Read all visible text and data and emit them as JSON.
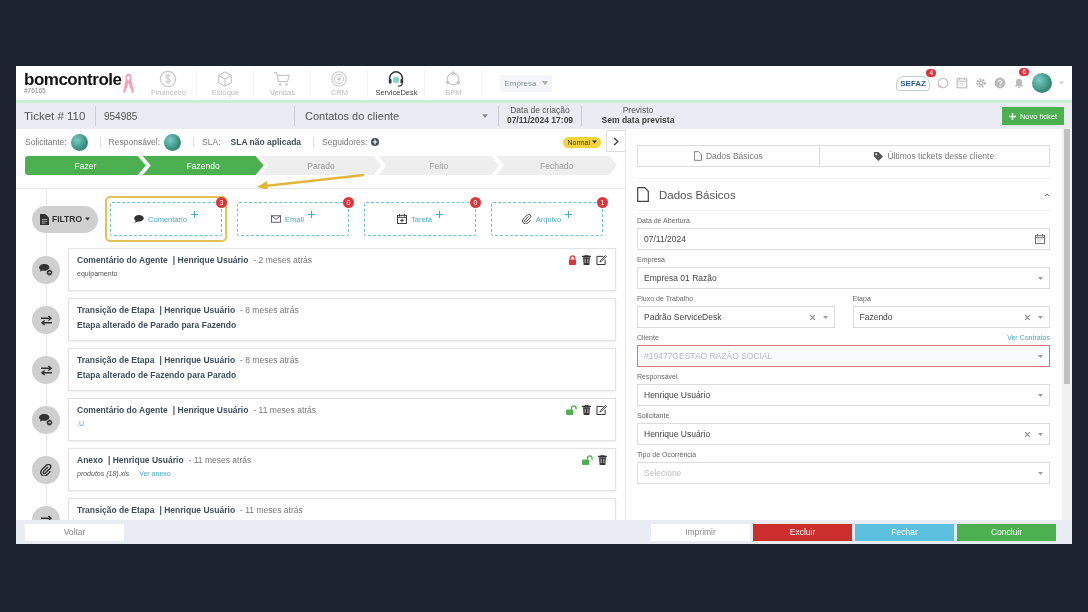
{
  "logo": {
    "text": "bomcontrole",
    "subtext": "#76165"
  },
  "modules": [
    {
      "label": "Financeiro",
      "selected": false
    },
    {
      "label": "Estoque",
      "selected": false
    },
    {
      "label": "Vendas",
      "selected": false
    },
    {
      "label": "CRM",
      "selected": false
    },
    {
      "label": "ServiceDesk",
      "selected": true
    },
    {
      "label": "BPM",
      "selected": false
    }
  ],
  "company_select": {
    "placeholder": "Empresa"
  },
  "sefaz": {
    "label": "SEFAZ",
    "badge": "4"
  },
  "notifications": {
    "badge": "6"
  },
  "ticket_bar": {
    "ticket": "Ticket # 110",
    "code": "954985",
    "contact": "Contatos do cliente",
    "created_label": "Data de criação",
    "created": "07/11/2024 17:09",
    "due_label": "Previsto",
    "due": "Sem data prevista"
  },
  "new_ticket_button": "Novo ticket",
  "info": {
    "requester_label": "Solicitante:",
    "assignee_label": "Responsável:",
    "sla_label": "SLA:",
    "sla": "SLA não aplicada",
    "followers_label": "Seguidores:",
    "priority": "Normal"
  },
  "stages": [
    {
      "label": "Fazer",
      "done": true
    },
    {
      "label": "Fazendo",
      "done": true
    },
    {
      "label": "Parado",
      "done": false
    },
    {
      "label": "Feito",
      "done": false
    },
    {
      "label": "Fechado",
      "done": false
    }
  ],
  "filter_button": "FILTRO",
  "actions": [
    {
      "label": "Comentário",
      "count": "3",
      "highlighted": true
    },
    {
      "label": "Email",
      "count": "0",
      "highlighted": false
    },
    {
      "label": "Tarefa",
      "count": "0",
      "highlighted": false
    },
    {
      "label": "Arquivo",
      "count": "1",
      "highlighted": false
    }
  ],
  "timeline": [
    {
      "kind": "comment",
      "title": "Comentário do Agente",
      "author": "| Henrique Usuário",
      "time": "- 2 meses atrás",
      "body": "equipamento",
      "locked": true
    },
    {
      "kind": "transition",
      "title": "Transição de Etapa",
      "author": "| Henrique Usuário",
      "time": "- 8 meses atrás",
      "body": "Etapa alterado de Parado para Fazendo"
    },
    {
      "kind": "transition",
      "title": "Transição de Etapa",
      "author": "| Henrique Usuário",
      "time": "- 8 meses atrás",
      "body": "Etapa alterado de Fazendo para Parado"
    },
    {
      "kind": "comment",
      "title": "Comentário do Agente",
      "author": "| Henrique Usuário",
      "time": "- 11 meses atrás",
      "body": ".U",
      "locked": false
    },
    {
      "kind": "attachment",
      "title": "Anexo",
      "author": "| Henrique Usuário",
      "time": "- 11 meses atrás",
      "body": "produtos (18).xls",
      "link": "Ver anexo",
      "locked": false
    },
    {
      "kind": "transition",
      "title": "Transição de Etapa",
      "author": "| Henrique Usuário",
      "time": "- 11 meses atrás"
    }
  ],
  "right_tabs": [
    "Dados Básicos",
    "Últimos tickets desse cliente"
  ],
  "form": {
    "title": "Dados Básicos",
    "expanded": true,
    "rows": [
      [
        {
          "label": "Data de Abertura",
          "value": "07/11/2024",
          "kind": "date",
          "clearable": false,
          "invalid": false
        }
      ],
      [
        {
          "label": "Empresa",
          "value": "Empresa 01 Razão",
          "kind": "select",
          "clearable": false,
          "invalid": false
        }
      ],
      [
        {
          "label": "Fluxo de Trabalho",
          "value": "Padrão ServiceDesk",
          "kind": "select",
          "clearable": true,
          "invalid": false
        },
        {
          "label": "Etapa",
          "value": "Fazendo",
          "kind": "select",
          "clearable": true,
          "invalid": false
        }
      ],
      [
        {
          "label": "Cliente",
          "placeholder": "#19477GESTAO RAZÃO SOCIAL",
          "kind": "select",
          "clearable": false,
          "invalid": true,
          "link": "Ver Contratos"
        }
      ],
      [
        {
          "label": "Responsável",
          "value": "Henrique Usuário",
          "kind": "select",
          "clearable": false,
          "invalid": false
        }
      ],
      [
        {
          "label": "Solicitante",
          "value": "Henrique Usuário",
          "kind": "select",
          "clearable": true,
          "invalid": false
        }
      ],
      [
        {
          "label": "Tipo de Ocorrência",
          "placeholder": "Selecione",
          "kind": "select",
          "clearable": false,
          "invalid": false
        }
      ]
    ]
  },
  "back_button": "Voltar",
  "footer_buttons": [
    {
      "label": "Imprimir",
      "kind": "print"
    },
    {
      "label": "Excluir",
      "kind": "danger"
    },
    {
      "label": "Fechar",
      "kind": "info"
    },
    {
      "label": "Concluir",
      "kind": "success"
    }
  ]
}
